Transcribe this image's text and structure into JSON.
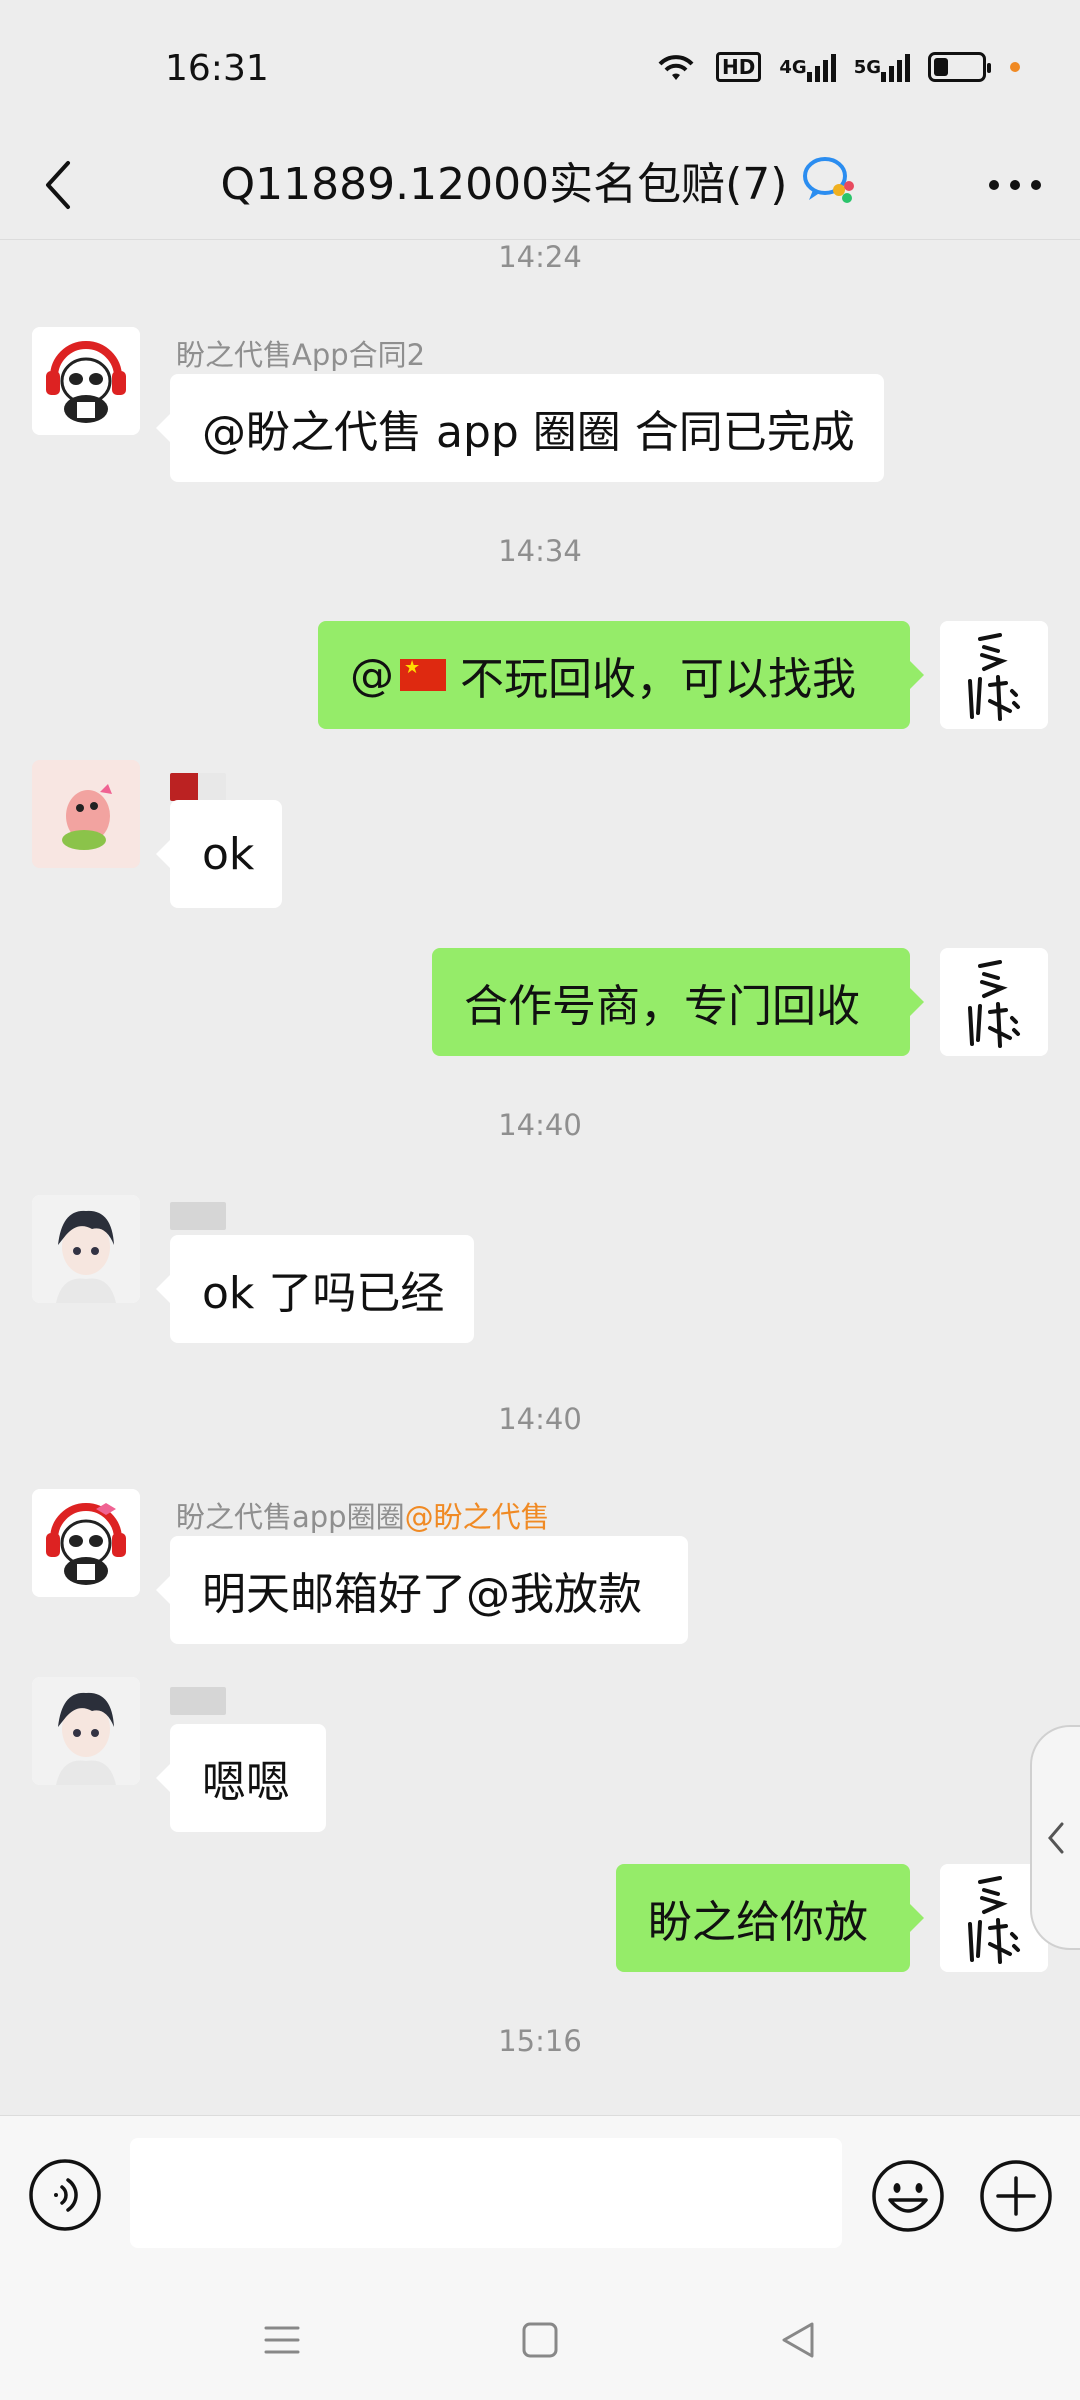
{
  "status_bar": {
    "time": "16:31",
    "hd_label": "HD",
    "net1_label": "4G",
    "net2_label": "5G"
  },
  "header": {
    "title": "Q11889.12000实名包赔(7)",
    "back_icon": "chevron-left-icon",
    "more_icon": "more-dots-icon",
    "group_icon": "group-chat-icon"
  },
  "messages": {
    "ts1": "14:24",
    "m1": {
      "sender": "盼之代售App合同2",
      "text": "@盼之代售 app 圈圈 合同已完成"
    },
    "ts2": "14:34",
    "m2": {
      "text_prefix": "@",
      "text": "不玩回收，可以找我"
    },
    "m3": {
      "text": "ok"
    },
    "m4": {
      "text": "合作号商，专门回收"
    },
    "ts3": "14:40",
    "m5": {
      "text": "ok 了吗已经"
    },
    "ts4": "14:40",
    "m6": {
      "sender": "盼之代售app圈圈",
      "mention": "@盼之代售",
      "text": "明天邮箱好了@我放款"
    },
    "m7": {
      "text": "嗯嗯"
    },
    "m8": {
      "text": "盼之给你放"
    },
    "ts5": "15:16"
  },
  "input_bar": {
    "voice_icon": "voice-icon",
    "emoji_icon": "emoji-icon",
    "plus_icon": "plus-icon",
    "placeholder": ""
  },
  "colors": {
    "background": "#ededed",
    "bubble_out": "#95ec69",
    "bubble_in": "#ffffff",
    "mention": "#f08a24"
  }
}
